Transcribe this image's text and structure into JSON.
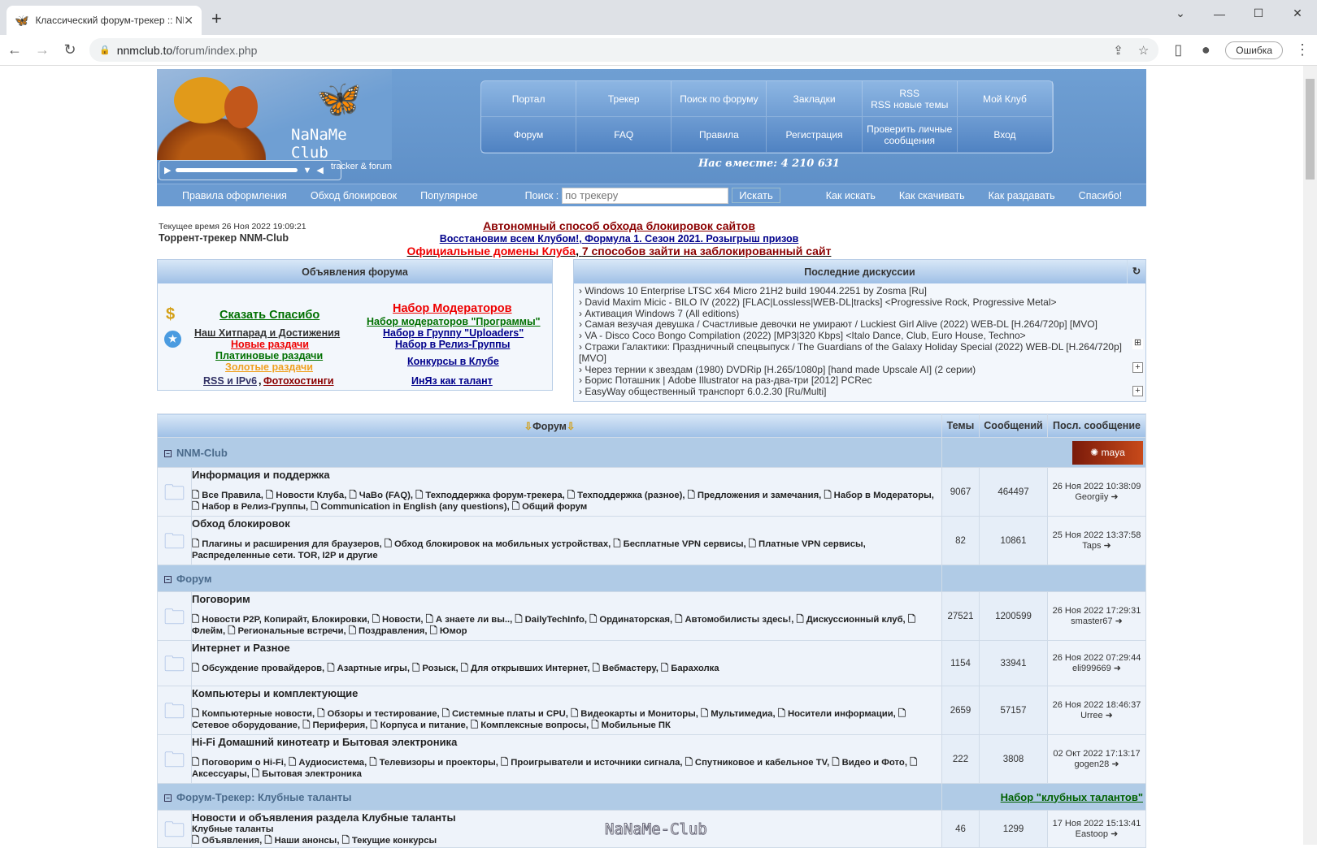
{
  "browser": {
    "tab_title": "Классический форум-трекер :: NNM-Club",
    "url_host": "nnmclub.to",
    "url_path": "/forum/index.php",
    "error_label": "Ошибка"
  },
  "header": {
    "brand": "NaNaMe Club",
    "tagline": "tracker & forum",
    "members": "Нас вместе: 4 210 631",
    "menu": [
      "Портал",
      "Трекер",
      "Поиск по форуму",
      "Закладки",
      "RSS\nRSS новые темы",
      "Мой Клуб",
      "Форум",
      "FAQ",
      "Правила",
      "Регистрация",
      "Проверить личные сообщения",
      "Вход"
    ]
  },
  "nav": {
    "left": [
      "Правила оформления",
      "Обход блокировок",
      "Популярное"
    ],
    "search_label": "Поиск :",
    "search_placeholder": "по трекеру",
    "search_button": "Искать",
    "right": [
      "Как искать",
      "Как скачивать",
      "Как раздавать",
      "Спасибо!"
    ]
  },
  "info": {
    "time": "Текущее время 26 Ноя 2022 19:09:21",
    "site": "Торрент-трекер NNM-Club",
    "ann1": "Автономный способ обхода блокировок сайтов",
    "ann2a": "Восстановим всем Клубом!",
    "ann2b": "Формула 1. Сезон 2021. Розыгрыш призов",
    "ann3a": "Официальные домены Клуба",
    "ann3b": "7 способов зайти на заблокированный сайт"
  },
  "adverts": {
    "title": "Объявления форума",
    "say_thanks": "Сказать Спасибо",
    "hitparade": "Наш Хитпарад и Достижения",
    "new": "Новые раздачи",
    "platinum": "Платиновые раздачи",
    "gold": "Золотые раздачи",
    "rss": "RSS и IPv6",
    "photo": "Фотохостинги",
    "mods": "Набор Модераторов",
    "mods_prog": "Набор модераторов \"Программы\"",
    "uploaders": "Набор в Группу \"Uploaders\"",
    "release": "Набор в Релиз-Группы",
    "contests": "Конкурсы в Клубе",
    "talent": "ИнЯз как талант"
  },
  "discussions": {
    "title": "Последние дискуссии",
    "items": [
      "› Windows 10 Enterprise LTSC x64 Micro 21H2 build 19044.2251 by Zosma [Ru]",
      "› David Maxim Micic - BILO IV (2022) [FLAC|Lossless|WEB-DL|tracks] <Progressive Rock, Progressive Metal>",
      "› Активация Windows 7 (All editions)",
      "› Самая везучая девушка / Счастливые девочки не умирают / Luckiest Girl Alive (2022) WEB-DL [H.264/720p] [MVO]",
      "› VA - Disco Coco Bongo Compilation (2022) [MP3|320 Kbps] <Italo Dance, Club, Euro House, Techno>",
      "› Стражи Галактики: Праздничный спецвыпуск / The Guardians of the Galaxy Holiday Special (2022) WEB-DL [H.264/720p] [MVO]",
      "› Через тернии к звездам (1980) DVDRip [H.265/1080p] [hand made Upscale AI] (2 серии)",
      "› Борис Поташник | Adobe Illustrator на раз-два-три [2012] PCRec",
      "› EasyWay общественный транспорт 6.0.2.30 [Ru/Multi]"
    ]
  },
  "table": {
    "headers": [
      "Форум",
      "Темы",
      "Сообщений",
      "Посл. сообщение"
    ],
    "sections": [
      {
        "name": "NNM-Club",
        "extra": "",
        "forums": [
          {
            "title": "Информация и поддержка",
            "subs": "🗋 Все Правила, 🗋 Новости Клуба, 🗋 ЧаВо (FAQ), 🗋 Техподдержка форум-трекера, 🗋 Техподдержка (разное), 🗋 Предложения и замечания, 🗋 Набор в Модераторы, 🗋 Набор в Релиз-Группы, 🗋 Communication in English (any questions), 🗋 Общий форум",
            "topics": "9067",
            "posts": "464497",
            "date": "26 Ноя 2022 10:38:09",
            "user": "Georgiiy"
          },
          {
            "title": "Обход блокировок",
            "subs": "🗋 Плагины и расширения для браузеров, 🗋 Обход блокировок на мобильных устройствах, 🗋 Бесплатные VPN сервисы, 🗋 Платные VPN сервисы, Распределенные сети. TOR, I2P и другие",
            "topics": "82",
            "posts": "10861",
            "date": "25 Ноя 2022 13:37:58",
            "user": "Taps"
          }
        ]
      },
      {
        "name": "Форум",
        "extra": "",
        "forums": [
          {
            "title": "Поговорим",
            "subs": "🗋 Новости P2P, Копирайт, Блокировки, 🗋 Новости, 🗋 А знаете ли вы.., 🗋 DailyTechInfo, 🗋 Ординаторская, 🗋 Автомобилисты здесь!, 🗋 Дискуссионный клуб, 🗋 Флейм, 🗋 Региональные встречи, 🗋 Поздравления, 🗋 Юмор",
            "topics": "27521",
            "posts": "1200599",
            "date": "26 Ноя 2022 17:29:31",
            "user": "smaster67"
          },
          {
            "title": "Интернет и Разное",
            "subs": "🗋 Обсуждение провайдеров, 🗋 Азартные игры, 🗋 Розыск, 🗋 Для открывших Интернет, 🗋 Вебмастеру, 🗋 Барахолка",
            "topics": "1154",
            "posts": "33941",
            "date": "26 Ноя 2022 07:29:44",
            "user": "eli999669"
          },
          {
            "title": "Компьютеры и комплектующие",
            "subs": "🗋 Компьютерные новости, 🗋 Обзоры и тестирование, 🗋 Системные платы и CPU, 🗋 Видеокарты и Мониторы, 🗋 Мультимедиа, 🗋 Носители информации, 🗋 Сетевое оборудование, 🗋 Периферия, 🗋 Корпуса и питание, 🗋 Комплексные вопросы, 🗋 Мобильные ПК",
            "topics": "2659",
            "posts": "57157",
            "date": "26 Ноя 2022 18:46:37",
            "user": "Urree"
          },
          {
            "title": "Hi-Fi Домашний кинотеатр и Бытовая электроника",
            "subs": "🗋 Поговорим о Hi-Fi, 🗋 Аудиосистема, 🗋 Телевизоры и проекторы, 🗋 Проигрыватели и источники сигнала, 🗋 Спутниковое и кабельное TV, 🗋 Видео и Фото, 🗋 Аксессуары, 🗋 Бытовая электроника",
            "topics": "222",
            "posts": "3808",
            "date": "02 Окт 2022 17:13:17",
            "user": "gogen28"
          }
        ]
      },
      {
        "name": "Форум-Трекер: Клубные таланты",
        "extra": "Набор \"клубных талантов\"",
        "forums": [
          {
            "title": "Новости и объявления раздела Клубные таланты",
            "subs": "Клубные таланты\n🗋 Объявления, 🗋 Наши анонсы, 🗋 Текущие конкурсы",
            "topics": "46",
            "posts": "1299",
            "date": "17 Ноя 2022 15:13:41",
            "user": "Eastoop"
          }
        ]
      }
    ]
  },
  "watermark": "NaNaMe-Club"
}
